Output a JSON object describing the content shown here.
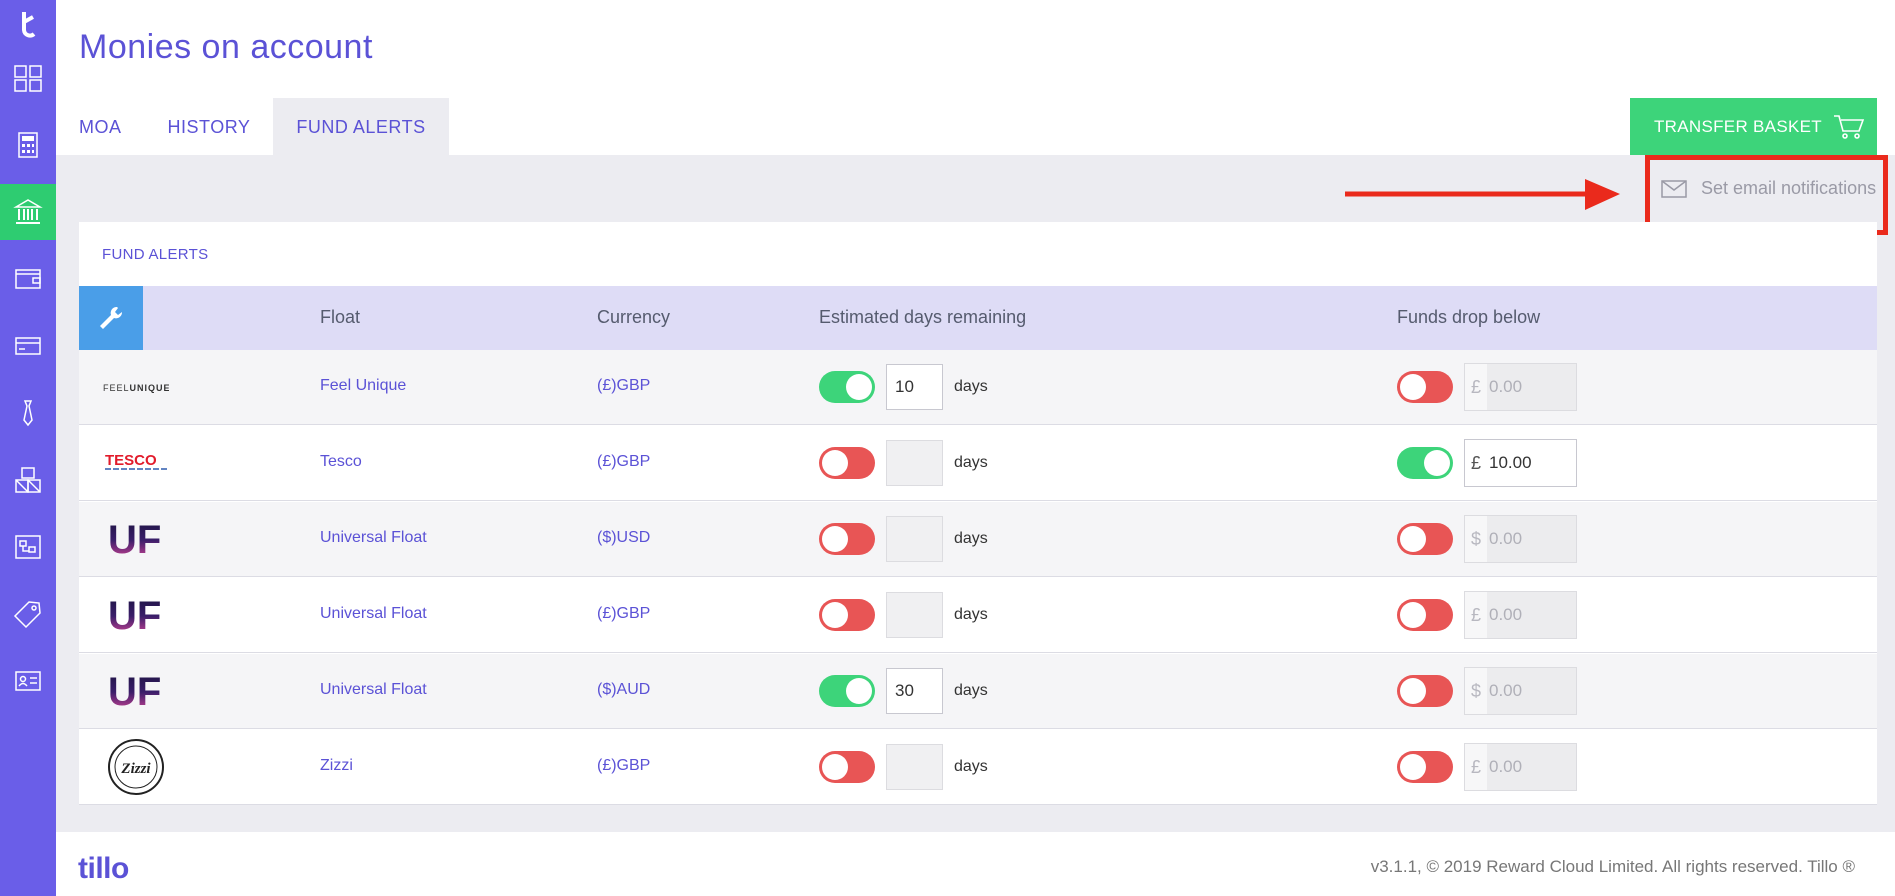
{
  "page": {
    "title": "Monies on account"
  },
  "tabs": [
    {
      "label": "MOA"
    },
    {
      "label": "HISTORY"
    },
    {
      "label": "FUND ALERTS"
    }
  ],
  "transfer_basket": {
    "label": "TRANSFER BASKET",
    "icon": "cart-icon"
  },
  "notifications": {
    "label": "Set email notifications",
    "icon": "envelope-icon"
  },
  "card": {
    "title": "FUND ALERTS",
    "headers": {
      "float": "Float",
      "currency": "Currency",
      "days": "Estimated days remaining",
      "funds": "Funds drop below"
    }
  },
  "rows": [
    {
      "logo": "FEELUNIQUE",
      "float": "Feel Unique",
      "currency": "(£)GBP",
      "days_on": true,
      "days": "10",
      "days_label": "days",
      "funds_on": false,
      "symbol": "£",
      "amount": "0.00"
    },
    {
      "logo": "TESCO",
      "float": "Tesco",
      "currency": "(£)GBP",
      "days_on": false,
      "days": "",
      "days_label": "days",
      "funds_on": true,
      "symbol": "£",
      "amount": "10.00"
    },
    {
      "logo": "UF",
      "float": "Universal Float",
      "currency": "($)USD",
      "days_on": false,
      "days": "",
      "days_label": "days",
      "funds_on": false,
      "symbol": "$",
      "amount": "0.00"
    },
    {
      "logo": "UF",
      "float": "Universal Float",
      "currency": "(£)GBP",
      "days_on": false,
      "days": "",
      "days_label": "days",
      "funds_on": false,
      "symbol": "£",
      "amount": "0.00"
    },
    {
      "logo": "UF",
      "float": "Universal Float",
      "currency": "($)AUD",
      "days_on": true,
      "days": "30",
      "days_label": "days",
      "funds_on": false,
      "symbol": "$",
      "amount": "0.00"
    },
    {
      "logo": "Zizzi",
      "float": "Zizzi",
      "currency": "(£)GBP",
      "days_on": false,
      "days": "",
      "days_label": "days",
      "funds_on": false,
      "symbol": "£",
      "amount": "0.00"
    }
  ],
  "footer": {
    "logo": "tillo",
    "text": "v3.1.1, © 2019 Reward Cloud Limited. All rights reserved. Tillo ®"
  },
  "colors": {
    "sidebar": "#6a5ee8",
    "accent": "#5b52d6",
    "green": "#3dd47a",
    "red_toggle": "#e85555",
    "highlight_red": "#ea2a1c"
  },
  "sidebar_icons": [
    "dashboard-icon",
    "calculator-icon",
    "bank-icon",
    "wallet-icon",
    "card-icon",
    "tie-icon",
    "boxes-icon",
    "org-chart-icon",
    "tag-icon",
    "id-card-icon"
  ]
}
